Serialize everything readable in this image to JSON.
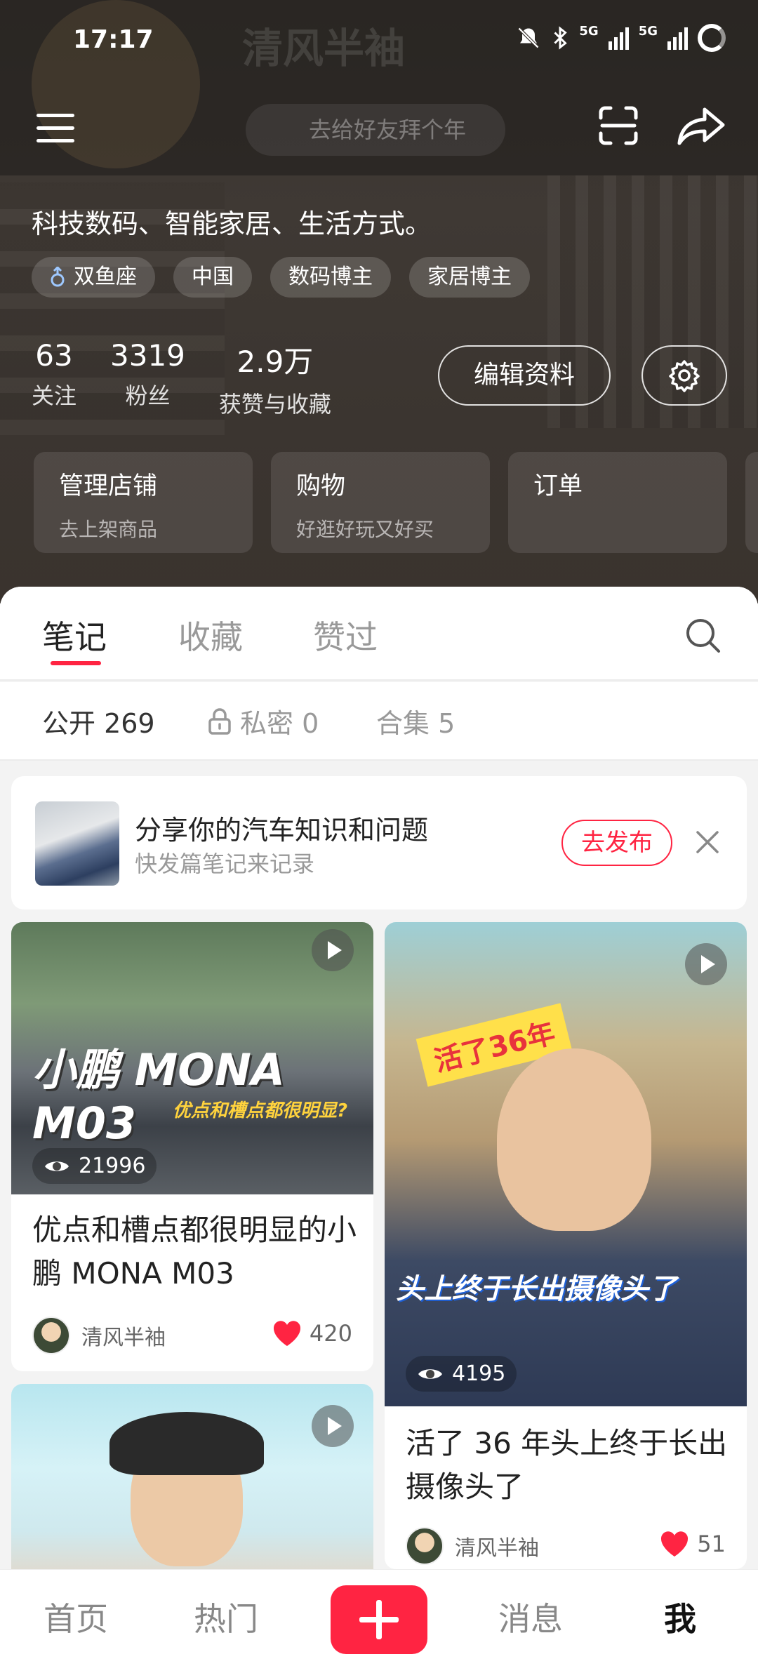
{
  "status_bar": {
    "time": "17:17",
    "net1": "5G",
    "net2": "5G"
  },
  "profile": {
    "name_ghost": "清风半袖",
    "ghost_pill": "去给好友拜个年",
    "bio": "科技数码、智能家居、生活方式。",
    "tags": [
      {
        "label": "双鱼座",
        "icon": "male-icon"
      },
      {
        "label": "中国"
      },
      {
        "label": "数码博主"
      },
      {
        "label": "家居博主"
      }
    ],
    "stats": [
      {
        "num": "63",
        "label": "关注"
      },
      {
        "num": "3319",
        "label": "粉丝"
      },
      {
        "num": "2.9万",
        "label": "获赞与收藏"
      }
    ],
    "edit_label": "编辑资料"
  },
  "service_cards": [
    {
      "title": "管理店铺",
      "sub": "去上架商品"
    },
    {
      "title": "购物",
      "sub": "好逛好玩又好买"
    },
    {
      "title": "订单",
      "sub": ""
    }
  ],
  "tabs": [
    "笔记",
    "收藏",
    "赞过"
  ],
  "subtabs": [
    {
      "label": "公开 269"
    },
    {
      "label": "私密 0"
    },
    {
      "label": "合集 5"
    }
  ],
  "promo": {
    "title": "分享你的汽车知识和问题",
    "subtitle": "快发篇笔记来记录",
    "button": "去发布"
  },
  "notes": [
    {
      "overlay_title": "小鹏 MONA M03",
      "overlay_sub": "优点和槽点都很明显?",
      "views": "21996",
      "title": "优点和槽点都很明显的小鹏 MONA M03",
      "author": "清风半袖",
      "likes": "420"
    },
    {
      "overlay_badge": "活了36年",
      "overlay_sub": "头上终于长出摄像头了",
      "views": "4195",
      "title": "活了 36 年头上终于长出摄像头了",
      "author": "清风半袖",
      "likes": "51"
    }
  ],
  "bottom_nav": [
    "首页",
    "热门",
    "消息",
    "我"
  ],
  "colors": {
    "accent": "#ff2442"
  }
}
